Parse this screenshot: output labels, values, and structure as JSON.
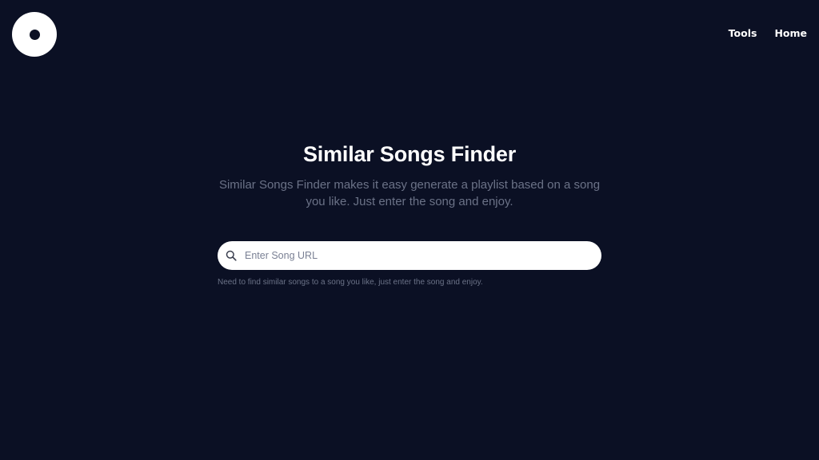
{
  "logo": {
    "icon": "disc-logo-icon"
  },
  "nav": {
    "items": [
      {
        "label": "Tools"
      },
      {
        "label": "Home"
      }
    ]
  },
  "hero": {
    "title": "Similar Songs Finder",
    "description": "Similar Songs Finder makes it easy generate a playlist based on a song you like. Just enter the song and enjoy."
  },
  "search": {
    "placeholder": "Enter Song URL",
    "value": "",
    "icon": "search-icon",
    "hint": "Need to find similar songs to a song you like, just enter the song and enjoy."
  },
  "colors": {
    "background": "#0b1024",
    "text": "#ffffff",
    "muted": "#6b7287",
    "input_bg": "#ffffff"
  }
}
